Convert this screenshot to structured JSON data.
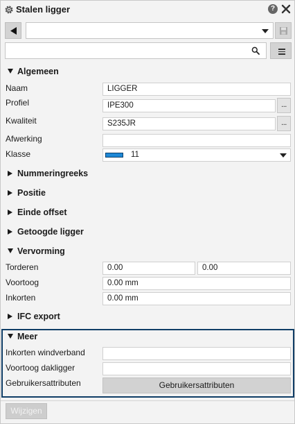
{
  "window": {
    "title": "Stalen ligger"
  },
  "toolbar": {
    "preset_value": ""
  },
  "search": {
    "value": "",
    "placeholder": ""
  },
  "sections": {
    "algemeen": {
      "title": "Algemeen",
      "naam_label": "Naam",
      "naam_value": "LIGGER",
      "profiel_label": "Profiel",
      "profiel_value": "IPE300",
      "kwaliteit_label": "Kwaliteit",
      "kwaliteit_value": "S235JR",
      "afwerking_label": "Afwerking",
      "afwerking_value": "",
      "klasse_label": "Klasse",
      "klasse_value": "11",
      "klasse_color": "#1e88d6"
    },
    "collapsed": [
      "Nummeringreeks",
      "Positie",
      "Einde offset",
      "Getoogde ligger"
    ],
    "vervorming": {
      "title": "Vervorming",
      "torderen_label": "Torderen",
      "torderen_value1": "0.00",
      "torderen_value2": "0.00",
      "voortoog_label": "Voortoog",
      "voortoog_value": "0.00 mm",
      "inkorten_label": "Inkorten",
      "inkorten_value": "0.00 mm"
    },
    "ifc": {
      "title": "IFC export"
    },
    "meer": {
      "title": "Meer",
      "inkorten_windverband_label": "Inkorten windverband",
      "inkorten_windverband_value": "",
      "voortoog_dakligger_label": "Voortoog dakligger",
      "voortoog_dakligger_value": "",
      "gebruikersattributen_label": "Gebruikersattributen",
      "gebruikersattributen_button": "Gebruikersattributen",
      "highlight_color": "#0f3d66"
    }
  },
  "footer": {
    "modify_button": "Wijzigen"
  },
  "icons": {
    "settings": "gear-icon",
    "help": "help-icon",
    "close": "close-icon",
    "back": "back-arrow-icon",
    "save": "save-icon",
    "search": "search-icon",
    "menu": "menu-icon",
    "more": "ellipsis-button"
  }
}
